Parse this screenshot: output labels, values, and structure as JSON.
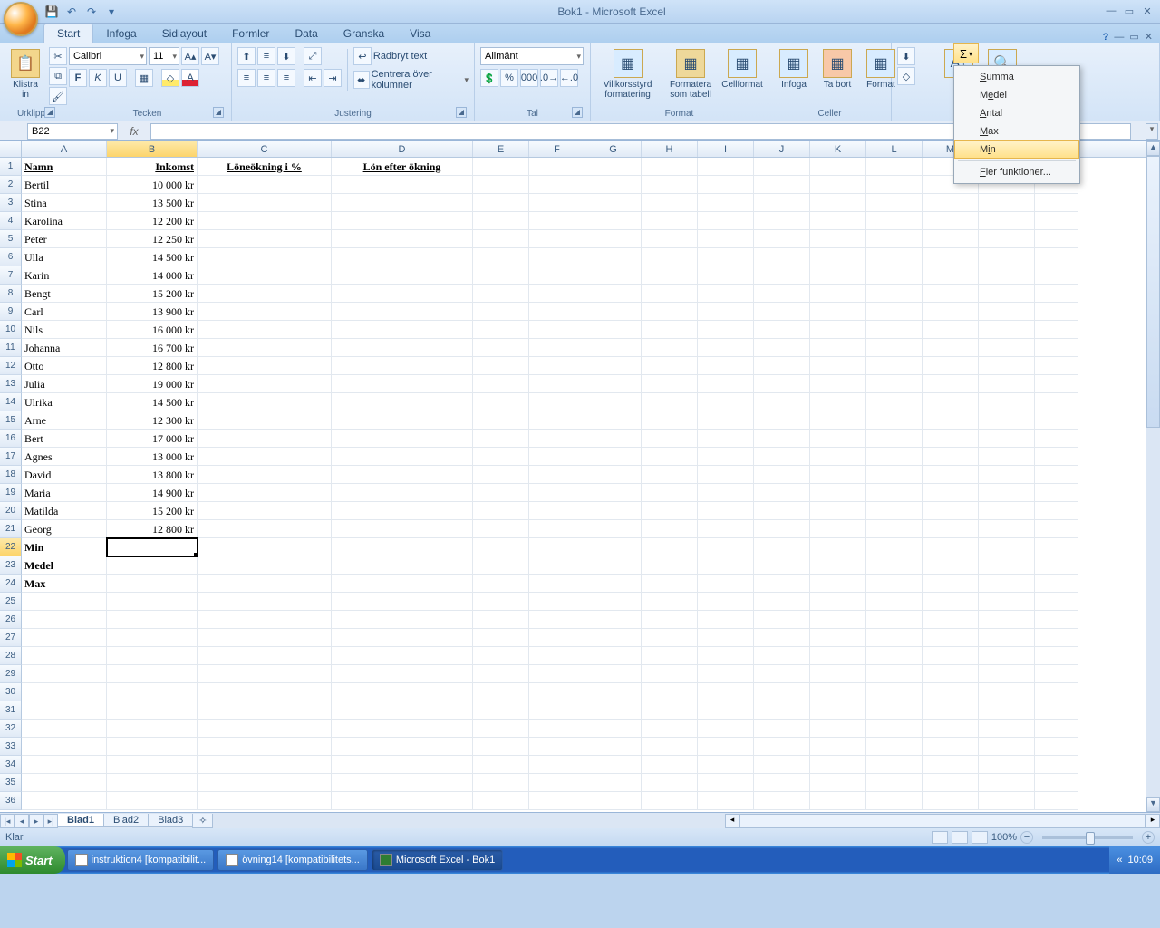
{
  "window": {
    "title": "Bok1 - Microsoft Excel"
  },
  "qat": {
    "save": "💾",
    "undo": "↶",
    "redo": "↷"
  },
  "tabs": [
    "Start",
    "Infoga",
    "Sidlayout",
    "Formler",
    "Data",
    "Granska",
    "Visa"
  ],
  "ribbon": {
    "clipboard": {
      "paste": "Klistra in",
      "label": "Urklipp"
    },
    "font": {
      "name": "Calibri",
      "size": "11",
      "label": "Tecken"
    },
    "align": {
      "wrap": "Radbryt text",
      "merge": "Centrera över kolumner",
      "label": "Justering"
    },
    "number": {
      "format": "Allmänt",
      "label": "Tal"
    },
    "styles": {
      "cond": "Villkorsstyrd formatering",
      "table": "Formatera som tabell",
      "cell": "Cellformat",
      "label": "Format"
    },
    "cells": {
      "insert": "Infoga",
      "delete": "Ta bort",
      "format": "Format",
      "label": "Celler"
    }
  },
  "autosum_menu": {
    "summa": "Summa",
    "medel": "Medel",
    "antal": "Antal",
    "max": "Max",
    "min": "Min",
    "more": "Fler funktioner..."
  },
  "namebox": "B22",
  "columns": [
    "A",
    "B",
    "C",
    "D",
    "E",
    "F",
    "G",
    "H",
    "I",
    "J",
    "K",
    "L",
    "M",
    "N",
    "O"
  ],
  "headers": {
    "A": "Namn",
    "B": "Inkomst",
    "C": "Löneökning i %",
    "D": "Lön efter ökning"
  },
  "rows": [
    {
      "n": "Bertil",
      "v": "10 000 kr"
    },
    {
      "n": "Stina",
      "v": "13 500 kr"
    },
    {
      "n": "Karolina",
      "v": "12 200 kr"
    },
    {
      "n": "Peter",
      "v": "12 250 kr"
    },
    {
      "n": "Ulla",
      "v": "14 500 kr"
    },
    {
      "n": "Karin",
      "v": "14 000 kr"
    },
    {
      "n": "Bengt",
      "v": "15 200 kr"
    },
    {
      "n": "Carl",
      "v": "13 900 kr"
    },
    {
      "n": "Nils",
      "v": "16 000 kr"
    },
    {
      "n": "Johanna",
      "v": "16 700 kr"
    },
    {
      "n": "Otto",
      "v": "12 800 kr"
    },
    {
      "n": "Julia",
      "v": "19 000 kr"
    },
    {
      "n": "Ulrika",
      "v": "14 500 kr"
    },
    {
      "n": "Arne",
      "v": "12 300 kr"
    },
    {
      "n": "Bert",
      "v": "17 000 kr"
    },
    {
      "n": "Agnes",
      "v": "13 000 kr"
    },
    {
      "n": "David",
      "v": "13 800 kr"
    },
    {
      "n": "Maria",
      "v": "14 900 kr"
    },
    {
      "n": "Matilda",
      "v": "15 200 kr"
    },
    {
      "n": "Georg",
      "v": "12 800 kr"
    }
  ],
  "statrows": [
    "Min",
    "Medel",
    "Max"
  ],
  "sheets": [
    "Blad1",
    "Blad2",
    "Blad3"
  ],
  "status": {
    "ready": "Klar",
    "zoom": "100%"
  },
  "taskbar": {
    "start": "Start",
    "items": [
      "instruktion4 [kompatibilit...",
      "övning14 [kompatibilitets...",
      "Microsoft Excel - Bok1"
    ],
    "time": "10:09"
  }
}
